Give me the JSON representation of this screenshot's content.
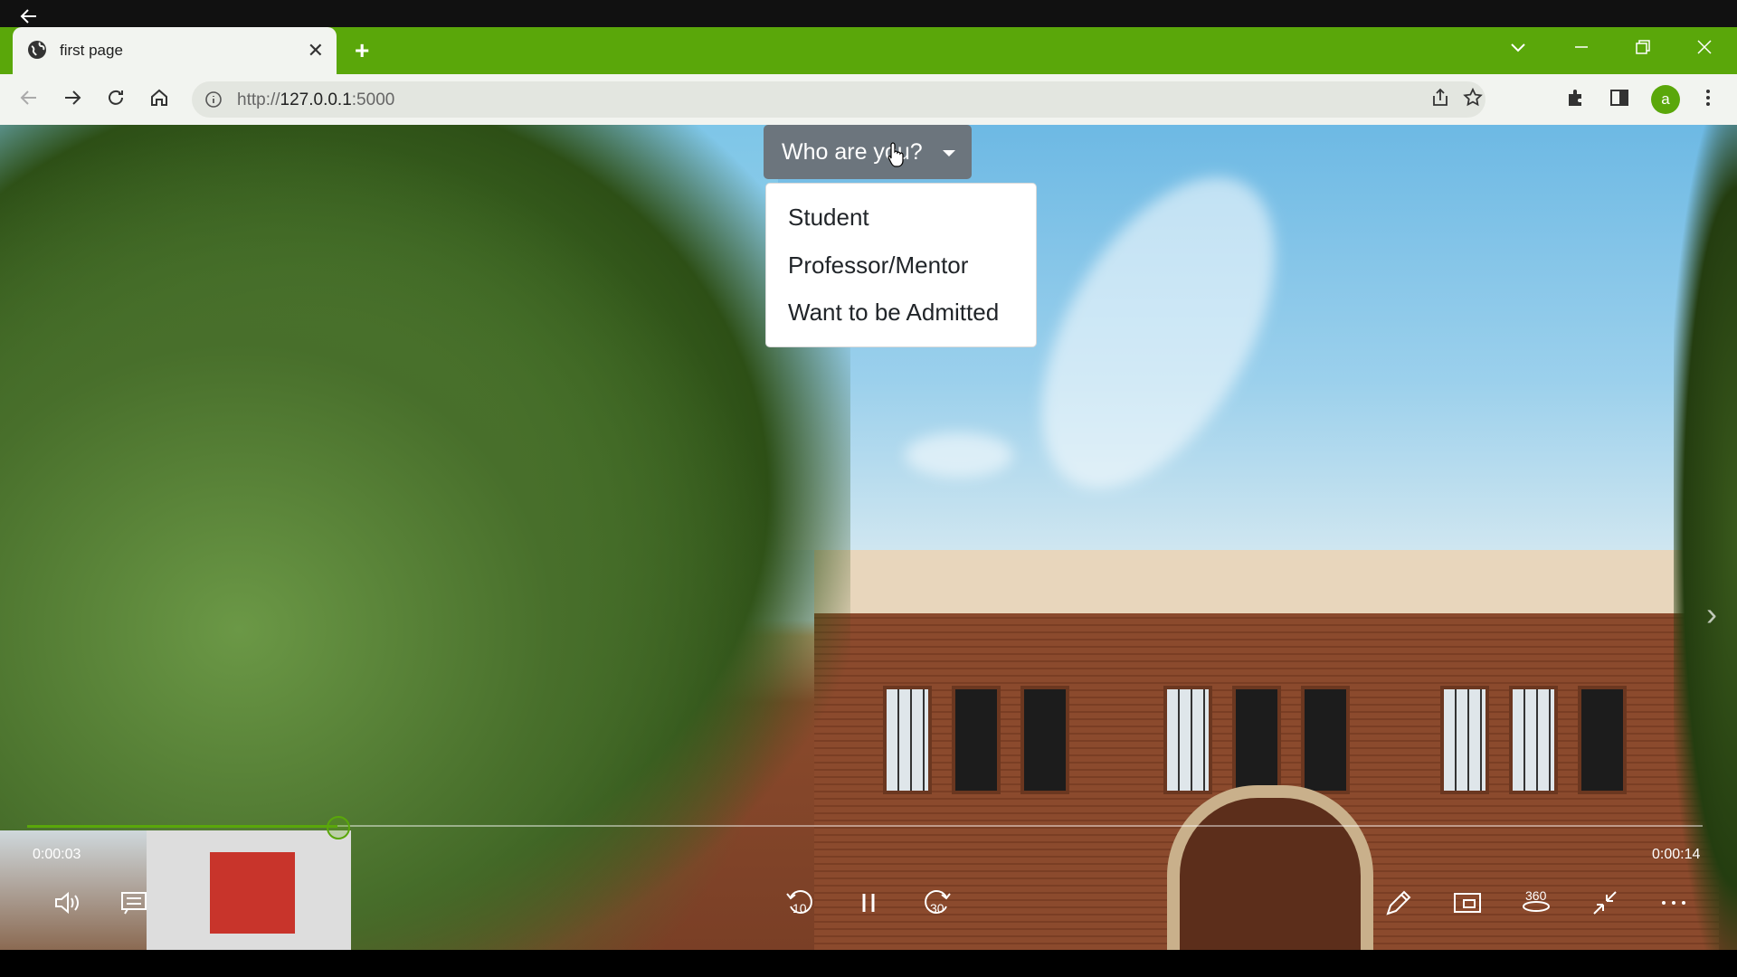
{
  "browser": {
    "tab_title": "first page",
    "url_prefix": "http://",
    "url_host": "127.0.0.1",
    "url_port": ":5000",
    "profile_initial": "a"
  },
  "dropdown": {
    "label": "Who are you?",
    "items": [
      "Student",
      "Professor/Mentor",
      "Want to be Admitted"
    ]
  },
  "player": {
    "current_time": "0:00:03",
    "total_time": "0:00:14",
    "progress": 0.185,
    "rewind_label": "10",
    "forward_label": "30",
    "view_360_label": "360"
  },
  "colors": {
    "accent": "#5aa70a",
    "dropdown_bg": "#6c757d"
  }
}
